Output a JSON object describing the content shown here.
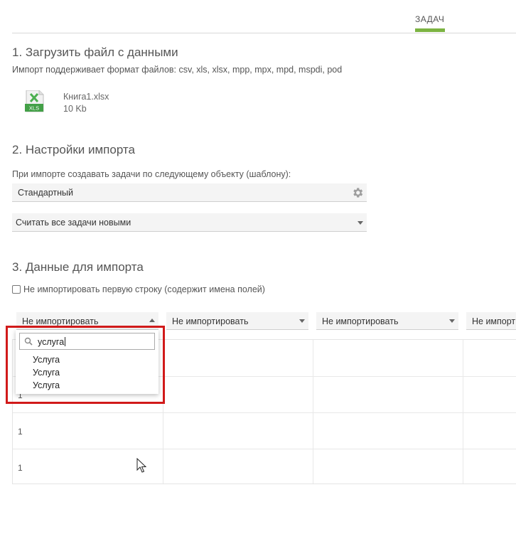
{
  "tabs": {
    "active_label": "ЗАДАЧ"
  },
  "step1": {
    "title": "1. Загрузить файл с данными",
    "hint": "Импорт поддерживает формат файлов: csv, xls, xlsx, mpp, mpx, mpd, mspdi, pod",
    "file": {
      "icon": "xls-file-icon",
      "icon_label": "XLS",
      "name": "Книга1.xlsx",
      "size": "10 Kb"
    }
  },
  "step2": {
    "title": "2. Настройки импорта",
    "template_hint": "При импорте создавать задачи по следующему объекту (шаблону):",
    "template_value": "Стандартный",
    "mode_value": "Считать все задачи новыми"
  },
  "step3": {
    "title": "3. Данные для импорта",
    "skip_first_row_label": "Не импортировать первую строку (содержит имена полей)",
    "skip_first_row_checked": false,
    "columns": [
      {
        "mapping": "Не импортировать"
      },
      {
        "mapping": "Не импортировать"
      },
      {
        "mapping": "Не импортировать"
      },
      {
        "mapping": "Не импорт"
      }
    ],
    "rows": [
      [
        "1"
      ],
      [
        "1"
      ],
      [
        "1"
      ],
      [
        "1"
      ]
    ],
    "dropdown": {
      "search_value": "услуга",
      "options": [
        "Услуга",
        "Услуга",
        "Услуга"
      ]
    }
  },
  "colors": {
    "accent": "#7cb342",
    "highlight": "#d11a1a"
  }
}
